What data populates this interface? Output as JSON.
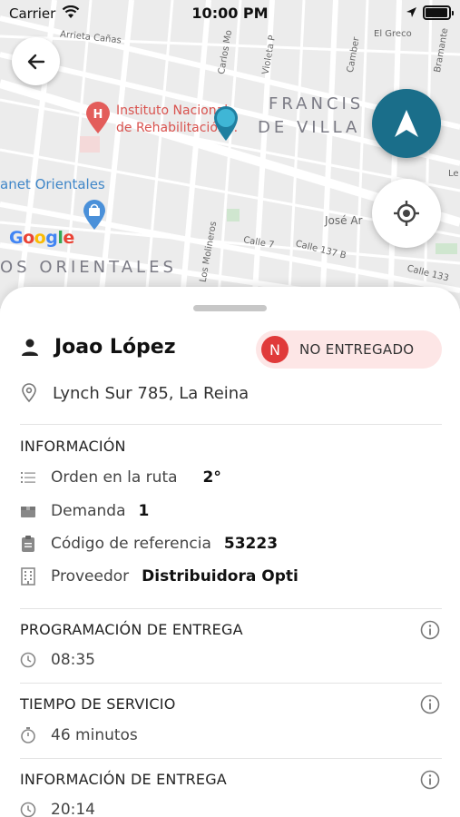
{
  "status_bar": {
    "carrier": "Carrier",
    "time": "10:00 PM"
  },
  "map": {
    "streets": {
      "arrieta": "Arrieta Cañas",
      "carlos": "Carlos Mo",
      "violeta": "Violeta P",
      "camberra": "Camber",
      "el_greco": "El Greco",
      "bramante": "Bramante",
      "jose": "José Ar",
      "calle7": "Calle 7",
      "calle137": "Calle 137 B",
      "calle133": "Calle 133",
      "molineros": "Los Molineros",
      "le": "Le"
    },
    "district_top_1": "FRANCIS",
    "district_top_2": "DE VILLA",
    "district_bottom": "OS ORIENTALES",
    "poi_instituto_1": "Instituto Nacional",
    "poi_instituto_2": "de Rehabilitación...",
    "poi_planet": "anet Orientales",
    "google_letters": [
      "G",
      "o",
      "o",
      "g",
      "l",
      "e"
    ]
  },
  "customer": {
    "name": "Joao López",
    "address": "Lynch Sur 785, La Reina"
  },
  "status_badge": {
    "letter": "N",
    "label": "NO ENTREGADO",
    "color": "#e03a3a",
    "bg": "#fde6e6"
  },
  "informacion": {
    "title": "INFORMACIÓN",
    "rows": [
      {
        "icon": "list-icon",
        "label": "Orden en la ruta",
        "value": "2°"
      },
      {
        "icon": "box-icon",
        "label": "Demanda",
        "value": "1"
      },
      {
        "icon": "clipboard-icon",
        "label": "Código de referencia",
        "value": "53223"
      },
      {
        "icon": "building-icon",
        "label": "Proveedor",
        "value": "Distribuidora Opti"
      }
    ]
  },
  "programacion": {
    "title": "PROGRAMACIÓN DE ENTREGA",
    "value": "08:35"
  },
  "tiempo_servicio": {
    "title": "TIEMPO DE SERVICIO",
    "value": "46 minutos"
  },
  "informacion_entrega": {
    "title": "INFORMACIÓN DE ENTREGA",
    "value": "20:14"
  },
  "colors": {
    "nav_button": "#1a6e8a",
    "marker": "#3fb6d6"
  }
}
